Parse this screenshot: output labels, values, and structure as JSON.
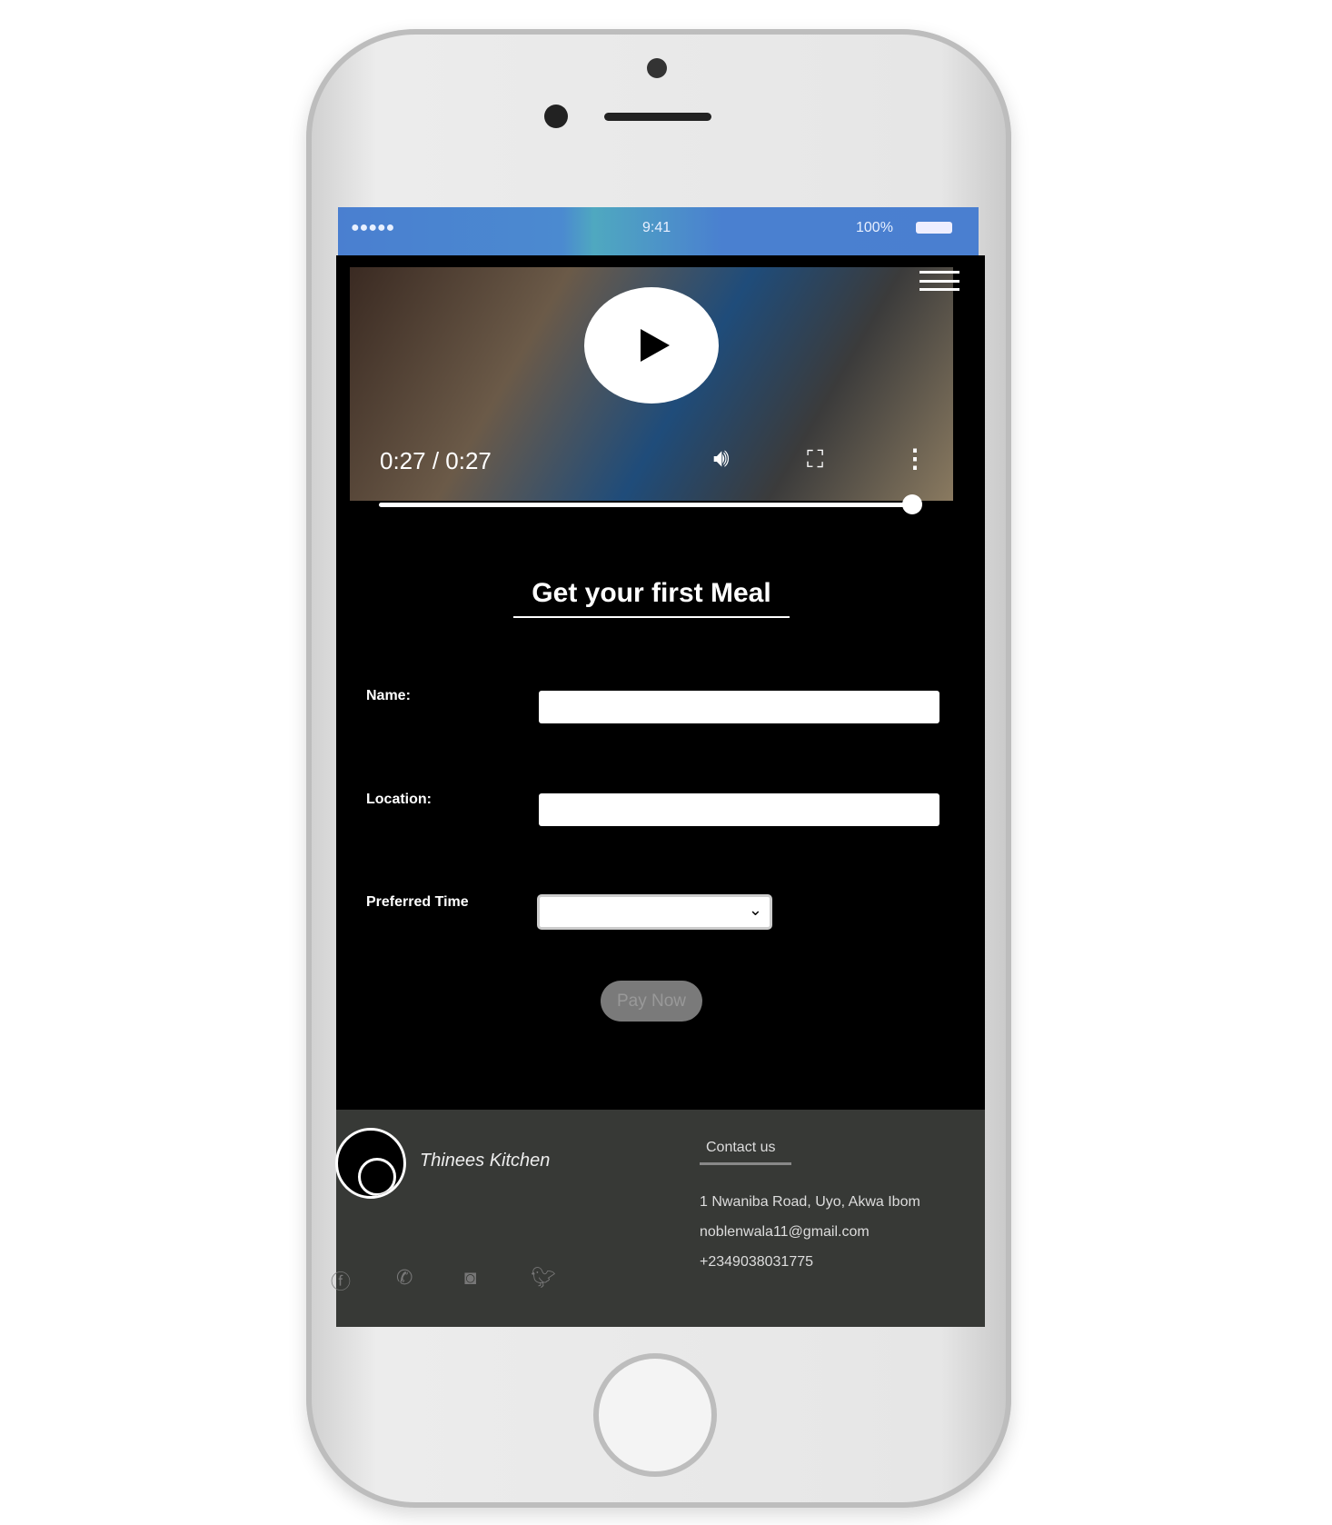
{
  "status_bar": {
    "signal": "●●●●●",
    "time": "9:41",
    "battery": "100%"
  },
  "video": {
    "time": "0:27 / 0:27",
    "progress": 1.0
  },
  "form": {
    "title": "Get your first Meal",
    "name_label": "Name:",
    "name_value": "",
    "location_label": "Location:",
    "location_value": "",
    "time_label": "Preferred Time",
    "time_value": "",
    "submit": "Pay Now"
  },
  "footer": {
    "brand": "Thinees Kitchen",
    "contact_heading": "Contact us",
    "address": "1 Nwaniba Road, Uyo, Akwa Ibom",
    "email": "noblenwala11@gmail.com",
    "phone": "+2349038031775"
  },
  "colors": {
    "screen_bg": "#000000",
    "footer_bg": "#373936",
    "button_bg": "#7a7a7a"
  }
}
